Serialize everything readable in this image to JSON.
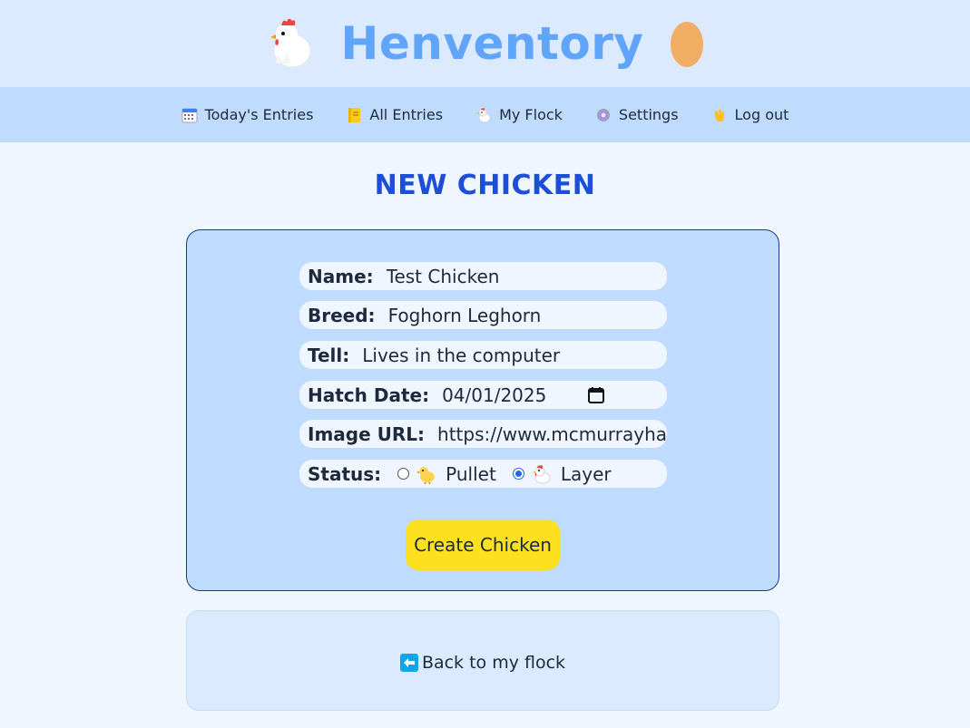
{
  "app": {
    "title": "Henventory",
    "logo_left_icon": "chicken-icon",
    "logo_right_icon": "egg-icon"
  },
  "nav": {
    "items": [
      {
        "label": "Today's Entries",
        "icon": "calendar-icon"
      },
      {
        "label": "All Entries",
        "icon": "notebook-icon"
      },
      {
        "label": "My Flock",
        "icon": "chicken-icon"
      },
      {
        "label": "Settings",
        "icon": "gear-icon"
      },
      {
        "label": "Log out",
        "icon": "waving-hand-icon"
      }
    ]
  },
  "page": {
    "title": "NEW CHICKEN"
  },
  "form": {
    "name_label": "Name:",
    "name_value": "Test Chicken",
    "breed_label": "Breed:",
    "breed_value": "Foghorn Leghorn",
    "tell_label": "Tell:",
    "tell_value": "Lives in the computer",
    "hatch_label": "Hatch Date:",
    "hatch_value": "04/01/2025",
    "image_label": "Image URL:",
    "image_value": "https://www.mcmurrayhatchery.com",
    "status_label": "Status:",
    "status_options": [
      {
        "label": "Pullet",
        "icon": "baby-chick-icon",
        "selected": false
      },
      {
        "label": "Layer",
        "icon": "chicken-icon",
        "selected": true
      }
    ],
    "submit_label": "Create Chicken"
  },
  "footer": {
    "back_label": "Back to my flock",
    "back_icon": "left-arrow-icon"
  },
  "colors": {
    "header_bg": "#dbeafe",
    "nav_bg": "#bfdbfe",
    "title_blue": "#1d4ed8",
    "brand_blue": "#60a5fa",
    "button_yellow": "#fde020"
  }
}
